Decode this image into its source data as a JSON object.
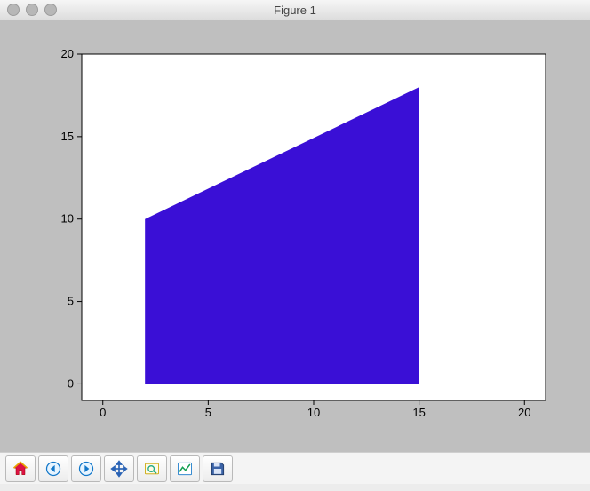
{
  "window": {
    "title": "Figure 1"
  },
  "toolbar": {
    "home": "Home",
    "back": "Back",
    "forward": "Forward",
    "pan": "Pan",
    "zoom": "Zoom",
    "subplots": "Configure subplots",
    "save": "Save"
  },
  "chart_data": {
    "type": "area",
    "title": "",
    "xlabel": "",
    "ylabel": "",
    "xlim": [
      -1,
      21
    ],
    "ylim": [
      -1,
      20
    ],
    "xticks": [
      0,
      5,
      10,
      15,
      20
    ],
    "yticks": [
      0,
      5,
      10,
      15,
      20
    ],
    "fill_color": "#3a0fd6",
    "polygon": [
      {
        "x": 2,
        "y": 0
      },
      {
        "x": 2,
        "y": 10
      },
      {
        "x": 15,
        "y": 18
      },
      {
        "x": 15,
        "y": 0
      }
    ]
  }
}
